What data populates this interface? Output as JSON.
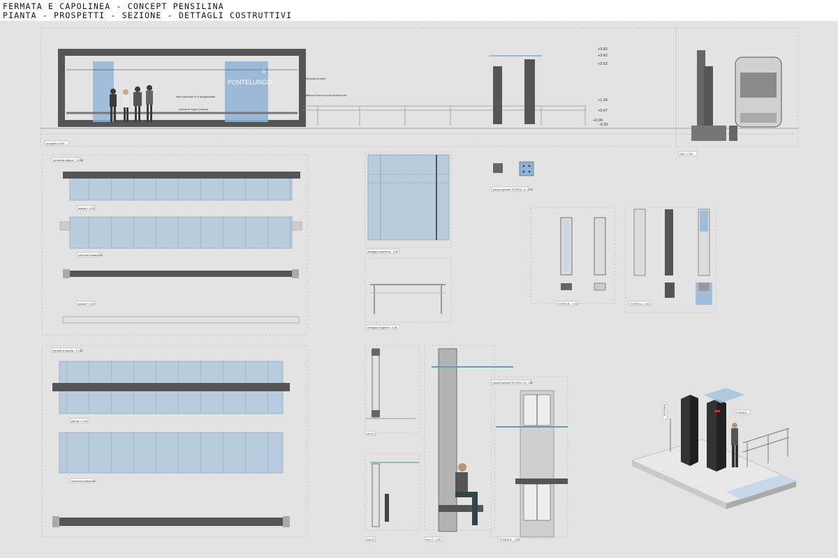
{
  "header": {
    "title_line1": "FERMATA E CAPOLINEA - CONCEPT PENSILINA",
    "title_line2": "PIANTA - PROSPETTI - SEZIONE - DETTAGLI COSTRUTTIVI"
  },
  "elevation": {
    "sign_number": "6",
    "sign_text": "PONTELUNGO",
    "note_glass": "vetro laminato 4+4 serigrafabile",
    "note_seat": "seduta in legno (rovere)",
    "note_lamp": "lampada lineare",
    "note_speaker": "diffusori sonori punto ricarica usb",
    "levels": [
      "+3.82",
      "+3.42",
      "+3.02",
      "+1.34",
      "+0.47",
      "+0.00",
      "-0.30"
    ],
    "title": "prospetto 1:50",
    "section_title": "sez - 1:50"
  },
  "plans": {
    "single_title": "pensilina singola - 1:100",
    "pianta_a": "pianta + 4.00",
    "schema": "schema fondazione",
    "pianta_b": "pianta + 0.90",
    "double_title": "pensilina doppia - 1:100",
    "pianta_c": "pianta + 4.00",
    "schema2": "schema fondazione"
  },
  "details": {
    "copertura": "dettaglio copertura - 1:50",
    "ringhiera": "dettaglio ringhiera - 1:50",
    "pianta_totem": "pianta copertura TOTEM A - B - 1:50",
    "totem_b": "TOTEM B - 1:50",
    "totem_a": "TOTEM A - 1:50",
    "sez_a": "sez A",
    "sez_b": "sez B",
    "sez_c": "sez C - 1:50",
    "pianta_totem2": "pianta copertura TOTEM A - B - 1:50",
    "totem_a2": "TOTEM A - 1:20"
  },
  "iso": {
    "totem_b": "TOTEM B",
    "totem_a": "TOTEM A"
  }
}
